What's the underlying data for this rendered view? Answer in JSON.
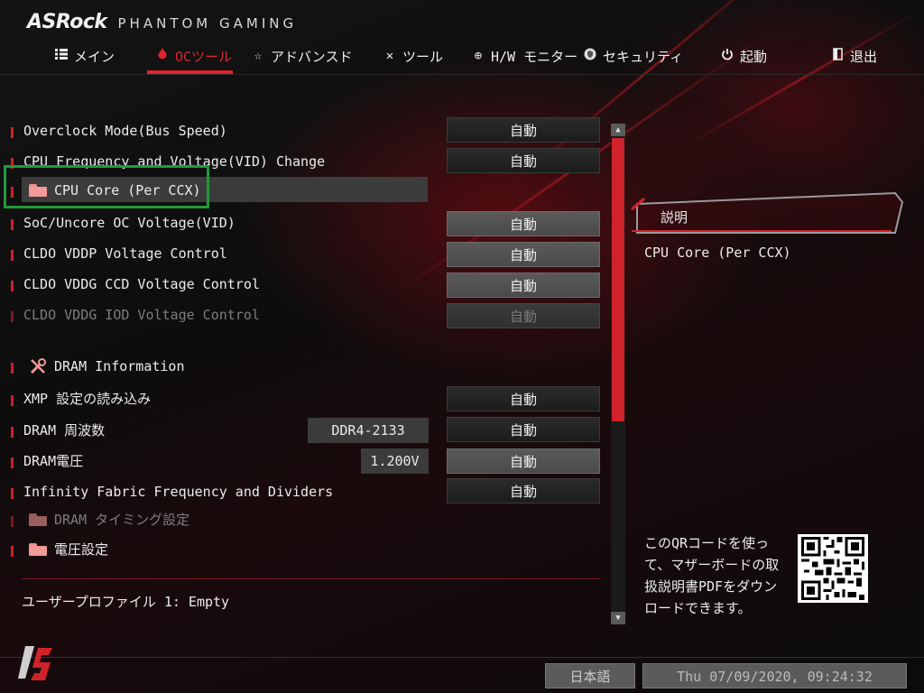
{
  "header": {
    "brand": "ASRock",
    "subtitle": "PHANTOM GAMING"
  },
  "nav": [
    {
      "label": "メイン",
      "icon": "list-icon"
    },
    {
      "label": "OCツール",
      "icon": "flame-icon",
      "active": true
    },
    {
      "label": "アドバンスド",
      "icon": "star-icon"
    },
    {
      "label": "ツール",
      "icon": "tools-icon"
    },
    {
      "label": "H/W モニター",
      "icon": "crosshair-icon"
    },
    {
      "label": "セキュリティ",
      "icon": "shield-icon"
    },
    {
      "label": "起動",
      "icon": "power-icon"
    },
    {
      "label": "退出",
      "icon": "exit-icon"
    }
  ],
  "settings": {
    "overclock_mode": {
      "label": "Overclock Mode(Bus Speed)",
      "value": "自動"
    },
    "cpu_freq_vid": {
      "label": "CPU Frequency and Voltage(VID) Change",
      "value": "自動"
    },
    "cpu_core": {
      "label": "CPU Core (Per CCX)"
    },
    "soc_uncore": {
      "label": "SoC/Uncore OC Voltage(VID)",
      "value": "自動"
    },
    "cldo_vddp": {
      "label": "CLDO VDDP Voltage Control",
      "value": "自動"
    },
    "cldo_vddg_ccd": {
      "label": "CLDO VDDG CCD Voltage Control",
      "value": "自動"
    },
    "cldo_vddg_iod": {
      "label": "CLDO VDDG IOD Voltage Control",
      "value": "自動"
    },
    "dram_info": {
      "label": "DRAM Information"
    },
    "xmp": {
      "label": "XMP 設定の読み込み",
      "value": "自動"
    },
    "dram_freq": {
      "label": "DRAM 周波数",
      "info": "DDR4-2133",
      "value": "自動"
    },
    "dram_voltage": {
      "label": "DRAM電圧",
      "info": "1.200V",
      "value": "自動"
    },
    "infinity_fabric": {
      "label": "Infinity Fabric Frequency and Dividers",
      "value": "自動"
    },
    "dram_timing": {
      "label": "DRAM タイミング設定"
    },
    "voltage_settings": {
      "label": "電圧設定"
    }
  },
  "profile": "ユーザープロファイル 1: Empty",
  "description": {
    "title": "説明",
    "text": "CPU Core (Per CCX)"
  },
  "qr_text": "このQRコードを使って、マザーボードの取扱説明書PDFをダウンロードできます。",
  "footer": {
    "language": "日本語",
    "datetime": "Thu 07/09/2020, 09:24:32"
  },
  "colors": {
    "accent": "#e0242c",
    "highlight_box": "#1f9b3a"
  }
}
